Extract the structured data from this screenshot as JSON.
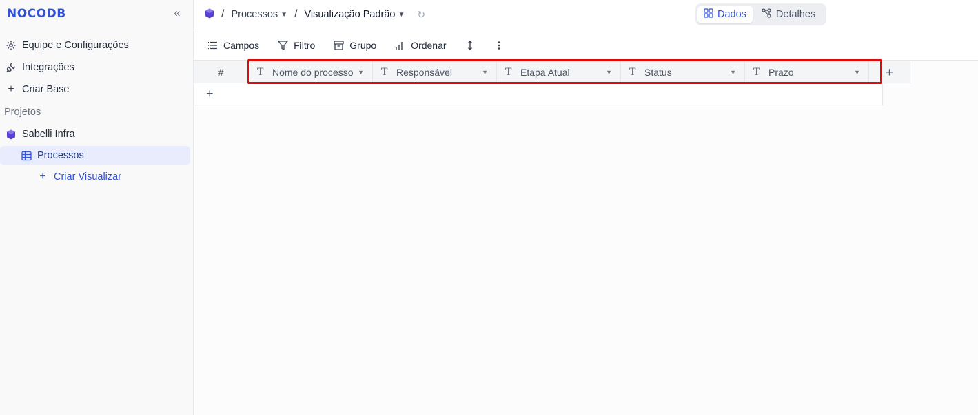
{
  "app": {
    "logo": "NOCODB"
  },
  "sidebar": {
    "collapse_icon": "double-chevron-left-icon",
    "items": [
      {
        "label": "Equipe e Configurações",
        "icon": "gear-icon"
      },
      {
        "label": "Integrações",
        "icon": "plug-icon"
      },
      {
        "label": "Criar Base",
        "icon": "plus-icon"
      }
    ],
    "section_label": "Projetos",
    "project": {
      "label": "Sabelli Infra",
      "icon": "cube-icon"
    },
    "table": {
      "label": "Processos",
      "icon": "table-icon"
    },
    "create_view": {
      "label": "Criar Visualizar",
      "icon": "plus-icon"
    }
  },
  "topbar": {
    "crumb_table": "Processos",
    "crumb_view": "Visualização Padrão",
    "tabs": [
      {
        "label": "Dados",
        "icon": "grid-icon",
        "active": true
      },
      {
        "label": "Detalhes",
        "icon": "nodes-icon",
        "active": false
      }
    ]
  },
  "toolbar": {
    "fields": "Campos",
    "filter": "Filtro",
    "group": "Grupo",
    "sort": "Ordenar"
  },
  "grid": {
    "row_number_header": "#",
    "columns": [
      {
        "label": "Nome do processo",
        "type": "text"
      },
      {
        "label": "Responsável",
        "type": "text"
      },
      {
        "label": "Etapa Atual",
        "type": "text"
      },
      {
        "label": "Status",
        "type": "text"
      },
      {
        "label": "Prazo",
        "type": "text"
      }
    ],
    "text_type_glyph": "T",
    "add_column": "+",
    "add_row": "+"
  },
  "colors": {
    "accent": "#3452d6",
    "highlight": "#e10a0a",
    "project_icon": "#5b3fd1"
  }
}
